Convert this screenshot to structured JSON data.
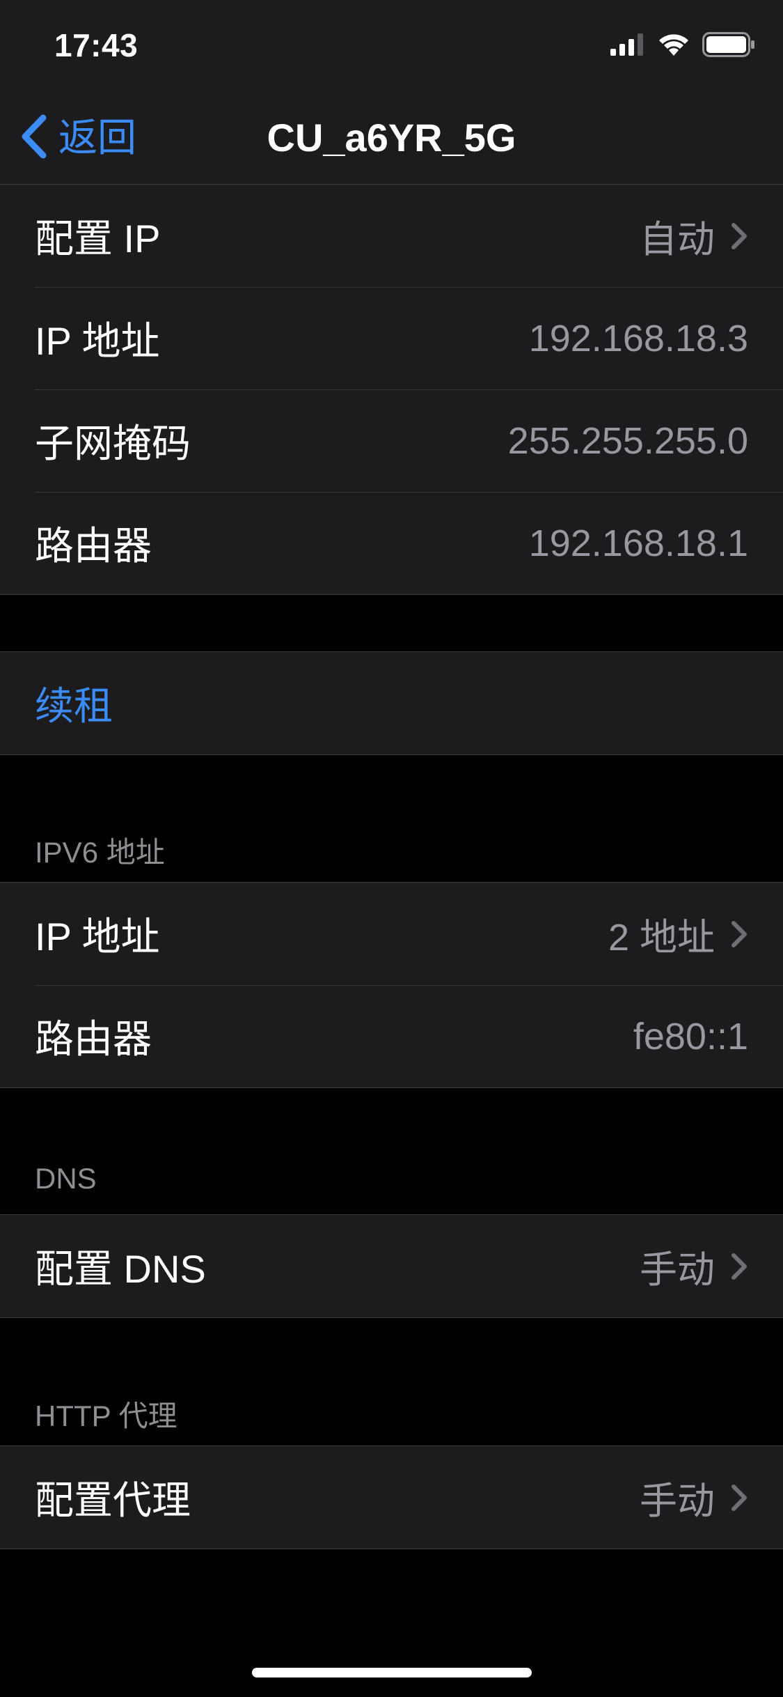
{
  "status_bar": {
    "time": "17:43",
    "icons": [
      "cellular-signal-icon",
      "wifi-icon",
      "battery-icon"
    ]
  },
  "nav": {
    "back_label": "返回",
    "title": "CU_a6YR_5G"
  },
  "ipv4_group": {
    "rows": [
      {
        "label": "配置 IP",
        "value": "自动",
        "chevron": true
      },
      {
        "label": "IP 地址",
        "value": "192.168.18.3",
        "chevron": false
      },
      {
        "label": "子网掩码",
        "value": "255.255.255.0",
        "chevron": false
      },
      {
        "label": "路由器",
        "value": "192.168.18.1",
        "chevron": false
      }
    ]
  },
  "renew": {
    "label": "续租"
  },
  "ipv6_group": {
    "header": "IPV6 地址",
    "rows": [
      {
        "label": "IP 地址",
        "value": "2 地址",
        "chevron": true
      },
      {
        "label": "路由器",
        "value": "fe80::1",
        "chevron": false
      }
    ]
  },
  "dns_group": {
    "header": "DNS",
    "rows": [
      {
        "label": "配置 DNS",
        "value": "手动",
        "chevron": true
      }
    ]
  },
  "proxy_group": {
    "header": "HTTP 代理",
    "rows": [
      {
        "label": "配置代理",
        "value": "手动",
        "chevron": true
      }
    ]
  },
  "colors": {
    "accent": "#3b8cf6",
    "background": "#000000",
    "cell": "#1c1c1e",
    "secondary_text": "#98989f"
  }
}
